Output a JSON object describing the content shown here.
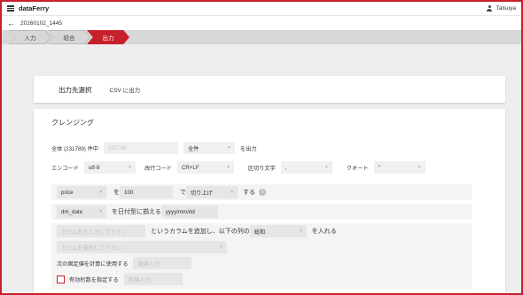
{
  "app": {
    "brand": "dataFerry",
    "user": "Tatsuya"
  },
  "job": {
    "id": "20160102_1445"
  },
  "steps": [
    {
      "label": "入力",
      "active": false
    },
    {
      "label": "結合",
      "active": false
    },
    {
      "label": "出力",
      "active": true
    }
  ],
  "output": {
    "label": "出力先選択",
    "value": "CSV に出力"
  },
  "cleansing": {
    "title": "クレンジング",
    "total_label": "全体 (231789) 件中",
    "total_placeholder": "231789",
    "total_select": "全件",
    "total_suffix": "を出力",
    "encode_label": "エンコード",
    "encode_value": "utf-8",
    "newline_label": "改行コード",
    "newline_value": "CR+LF",
    "delim_label": "区切り文字",
    "delim_value": ",",
    "quote_label": "クオート",
    "quote_value": "\"",
    "rule1": {
      "column": "price",
      "op": "を",
      "value": "100",
      "de": "で",
      "mode": "切り上げ",
      "suffix": "する"
    },
    "rule2": {
      "column": "dm_date",
      "op": "を日付型に揃える",
      "format": "yyyy/mm/dd"
    },
    "rule3": {
      "placeholder": "カラム名を入力して下さい",
      "middle": "というカラムを追加し、以下の列の",
      "agg": "総和",
      "suffix": "を入れる"
    },
    "rule3b": {
      "placeholder": "カラムを選択して下さい"
    },
    "rule4": {
      "label": "次の固定値を計算に使用する",
      "placeholder": "数値入力"
    },
    "rule5": {
      "label": "有効桁数を指定する",
      "placeholder": "数値入力"
    }
  }
}
